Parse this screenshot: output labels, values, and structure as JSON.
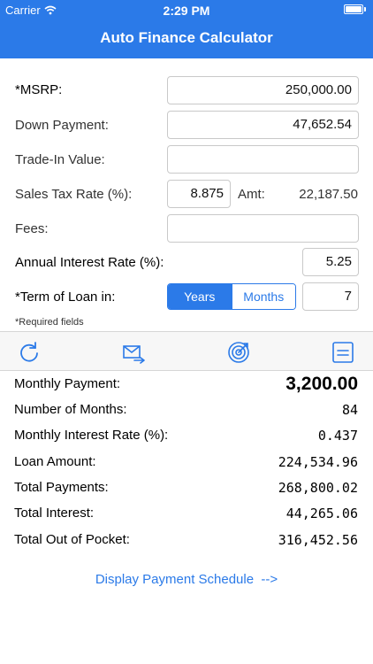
{
  "status_bar": {
    "carrier": "Carrier",
    "time": "2:29 PM"
  },
  "nav": {
    "title": "Auto Finance Calculator"
  },
  "form": {
    "msrp_label": "*MSRP:",
    "msrp_value": "250,000.00",
    "down_payment_label": "Down Payment:",
    "down_payment_value": "47,652.54",
    "trade_in_label": "Trade-In Value:",
    "trade_in_value": "",
    "sales_tax_label": "Sales Tax Rate (%):",
    "sales_tax_value": "8.875",
    "amt_label": "Amt:",
    "amt_value": "22,187.50",
    "fees_label": "Fees:",
    "fees_value": "",
    "interest_label": "Annual Interest Rate (%):",
    "interest_value": "5.25",
    "term_label": "*Term of Loan in:",
    "term_years": "Years",
    "term_months": "Months",
    "term_selected": "Years",
    "term_value": "7",
    "required_note": "*Required fields"
  },
  "toolbar": {
    "icons": [
      "refresh-icon",
      "email-icon",
      "target-icon",
      "list-icon"
    ]
  },
  "results": {
    "monthly_payment_label": "Monthly Payment:",
    "monthly_payment_value": "3,200.00",
    "num_months_label": "Number of Months:",
    "num_months_value": "84",
    "monthly_rate_label": "Monthly Interest Rate (%):",
    "monthly_rate_value": "0.437",
    "loan_amount_label": "Loan Amount:",
    "loan_amount_value": "224,534.96",
    "total_payments_label": "Total Payments:",
    "total_payments_value": "268,800.02",
    "total_interest_label": "Total Interest:",
    "total_interest_value": "44,265.06",
    "total_out_label": "Total Out of Pocket:",
    "total_out_value": "316,452.56"
  },
  "link": {
    "schedule": "Display Payment Schedule  -->"
  },
  "colors": {
    "accent": "#2b7ae8"
  }
}
